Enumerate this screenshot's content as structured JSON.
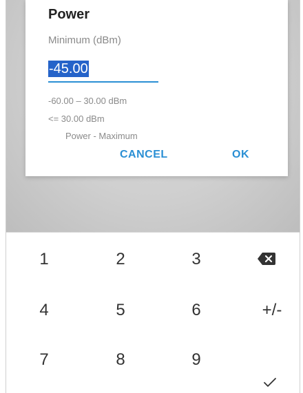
{
  "dialog": {
    "title": "Power",
    "subtitle": "Minimum (dBm)",
    "value": "-45.00",
    "range": "-60.00 – 30.00 dBm",
    "limit": "<= 30.00 dBm",
    "limit_reference": "Power - Maximum",
    "cancel_label": "CANCEL",
    "ok_label": "OK"
  },
  "keypad": {
    "keys": [
      "1",
      "2",
      "3",
      "4",
      "5",
      "6",
      "+/-",
      "7",
      "8",
      "9"
    ],
    "backspace_icon": "backspace-icon",
    "confirm_icon": "checkmark-icon"
  },
  "colors": {
    "accent": "#2a8fd4",
    "selection": "#2563c9",
    "scrim": "#cfcfcf"
  }
}
